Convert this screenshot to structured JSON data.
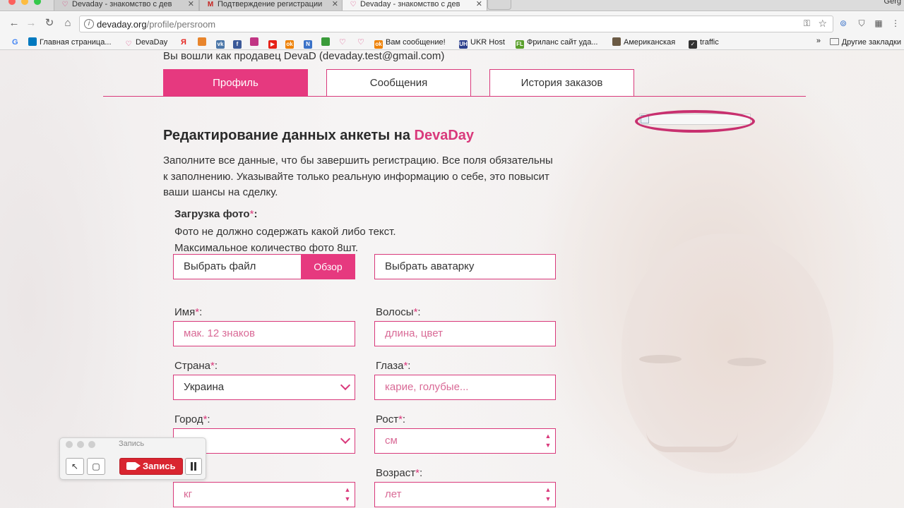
{
  "browser": {
    "tabs": [
      {
        "title": "Devaday - знакомство с дев",
        "icon": "devaday-favicon-icon",
        "active": false
      },
      {
        "title": "Подтверждение регистрации",
        "icon": "gmail-icon",
        "active": false
      },
      {
        "title": "Devaday - знакомство с дев",
        "icon": "devaday-favicon-icon",
        "active": true
      }
    ],
    "profile_name": "Gerg",
    "url_host": "devaday.org",
    "url_path": "/profile/persroom",
    "bookmarks": [
      {
        "label": "Главная страница...",
        "icon": "trello-icon",
        "color": "#0079bf"
      },
      {
        "label": "DevaDay",
        "icon": "devaday-favicon-icon",
        "color": "#d9397b"
      },
      {
        "label": "",
        "icon": "yandex-icon",
        "color": "#e52620"
      },
      {
        "label": "",
        "icon": "ext-orange-icon",
        "color": "#e8852c"
      },
      {
        "label": "",
        "icon": "vk-icon",
        "color": "#4a76a8"
      },
      {
        "label": "",
        "icon": "facebook-icon",
        "color": "#3b5998"
      },
      {
        "label": "",
        "icon": "instagram-icon",
        "color": "#c13584"
      },
      {
        "label": "",
        "icon": "youtube-icon",
        "color": "#e62117"
      },
      {
        "label": "",
        "icon": "odnoklassniki-icon",
        "color": "#ee8208"
      },
      {
        "label": "",
        "icon": "ext-blue-icon",
        "color": "#3a72c8"
      },
      {
        "label": "",
        "icon": "ext-green-icon",
        "color": "#3a9b3a"
      },
      {
        "label": "",
        "icon": "devaday-favicon-icon",
        "color": "#d9397b"
      },
      {
        "label": "",
        "icon": "devaday-favicon-icon",
        "color": "#d9397b"
      },
      {
        "label": "Вам сообщение!",
        "icon": "odnoklassniki-icon",
        "color": "#ee8208"
      },
      {
        "label": "UKR Host",
        "icon": "ukrhost-icon",
        "color": "#2b3f8c"
      },
      {
        "label": "Фриланс сайт уда...",
        "icon": "freelancehunt-icon",
        "color": "#5aa02c"
      },
      {
        "label": "Американская",
        "icon": "photo-icon",
        "color": "#6b5a44"
      },
      {
        "label": "traffic",
        "icon": "traffic-icon",
        "color": "#333333"
      }
    ],
    "bookmarks_more": "»",
    "other_bookmarks": "Другие закладки"
  },
  "page": {
    "logged_as": "Вы вошли как продавец DevaD (devaday.test@gmail.com)",
    "tabs": [
      "Профиль",
      "Сообщения",
      "История заказов"
    ],
    "title_prefix": "Редактирование данных анкеты на ",
    "title_brand": "DevaDay",
    "intro": "Заполните все данные, что бы завершить регистрацию. Все поля обязательны к заполнению. Указывайте только реальную информацию о себе, это повысит ваши шансы на сделку.",
    "photo_label": "Загрузка фото",
    "required_mark": "*",
    "photo_note_1": "Фото не должно содержать какой либо текст.",
    "photo_note_2": "Максимальное количество фото 8шт.",
    "file_input": "Выбрать файл",
    "browse_btn": "Обзор",
    "avatar_input": "Выбрать аватарку",
    "fields": {
      "name": {
        "label": "Имя",
        "colon": ":",
        "placeholder": "мак. 12 знаков"
      },
      "hair": {
        "label": "Волосы",
        "colon": ":",
        "placeholder": "длина, цвет"
      },
      "country": {
        "label": "Страна",
        "colon": ":",
        "value": "Украина"
      },
      "eyes": {
        "label": "Глаза",
        "colon": ":",
        "placeholder": "карие, голубые..."
      },
      "city": {
        "label": "Город",
        "colon": ":",
        "value": ""
      },
      "height": {
        "label": "Рост",
        "colon": ":",
        "placeholder": "см"
      },
      "weight": {
        "placeholder": "кг"
      },
      "age": {
        "label": "Возраст",
        "colon": ":",
        "placeholder": "лет"
      }
    }
  },
  "recorder": {
    "title": "Запись",
    "record_label": "Запись"
  },
  "colors": {
    "brand_pink": "#e6397f",
    "record_red": "#d92530"
  }
}
